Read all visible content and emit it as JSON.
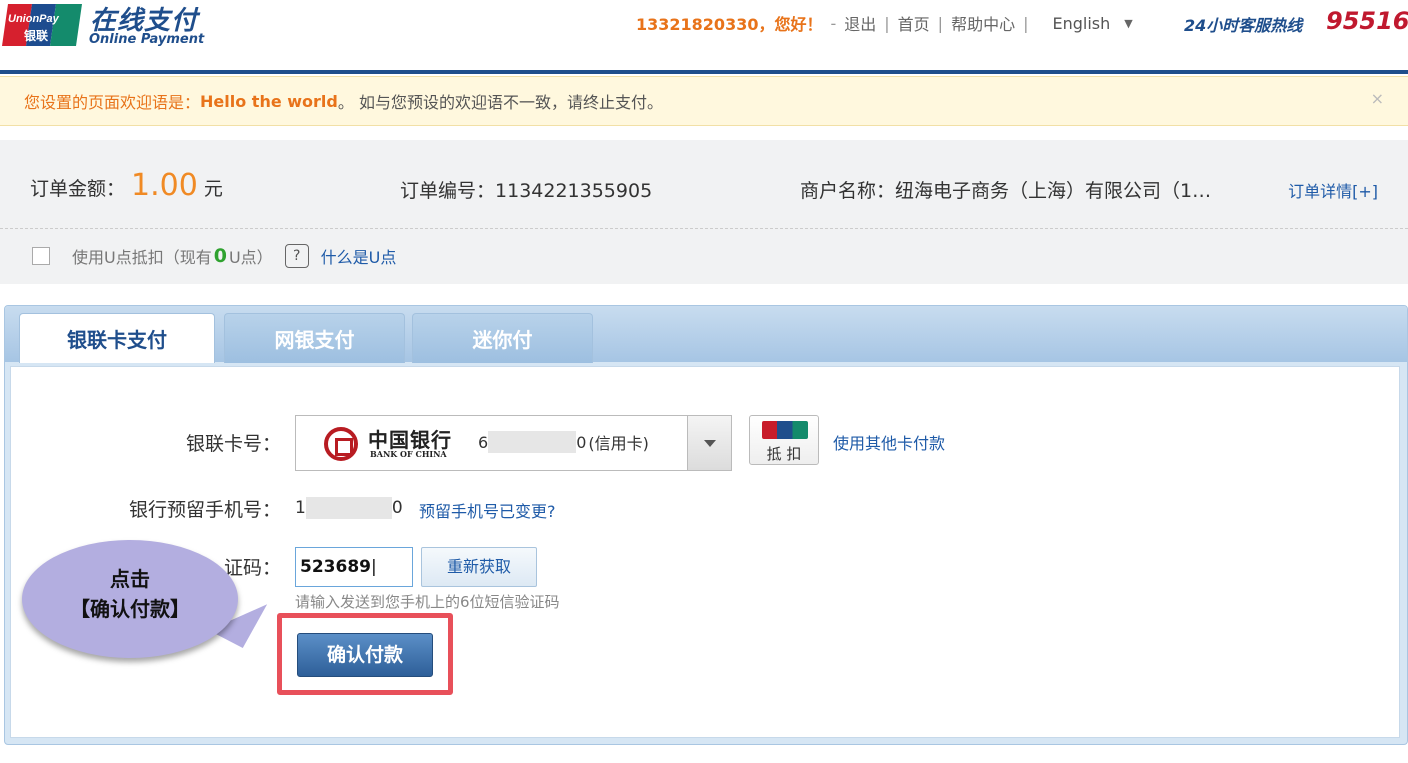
{
  "header": {
    "logo_brand": "UnionPay",
    "logo_sub": "银联",
    "title_cn": "在线支付",
    "title_en": "Online Payment",
    "user": "13321820330，您好！",
    "logout": "退出",
    "home": "首页",
    "help": "帮助中心",
    "language": "English",
    "hotline_label": "24小时客服热线",
    "hotline_number": "95516"
  },
  "notice": {
    "prefix": "您设置的页面欢迎语是：",
    "greeting": "Hello the world",
    "suffix": "。 如与您预设的欢迎语不一致，请终止支付。",
    "close": "×"
  },
  "order": {
    "amount_label": "订单金额：",
    "amount": "1.00",
    "currency": "元",
    "order_no_label": "订单编号：",
    "order_no": "1134221355905",
    "merchant_label": "商户名称：",
    "merchant": "纽海电子商务（上海）有限公司（1…",
    "detail_link": "订单详情[+]",
    "upoint_text_1": "使用U点抵扣（现有",
    "upoint_count": "0",
    "upoint_text_2": "U点）",
    "upoint_help": "?",
    "upoint_link": "什么是U点"
  },
  "tabs": [
    {
      "label": "银联卡支付",
      "active": true
    },
    {
      "label": "网银支付",
      "active": false
    },
    {
      "label": "迷你付",
      "active": false
    }
  ],
  "form": {
    "card_label": "银联卡号：",
    "bank_name_cn": "中国银行",
    "bank_name_en": "BANK OF CHINA",
    "card_first": "6",
    "card_last": "0",
    "card_type": "(信用卡)",
    "discount_label": "抵 扣",
    "other_card": "使用其他卡付款",
    "phone_label": "银行预留手机号：",
    "phone_first": "1",
    "phone_last": "0",
    "phone_change": "预留手机号已变更?",
    "code_label": "证码：",
    "code_value": "523689",
    "resend": "重新获取",
    "hint": "请输入发送到您手机上的6位短信验证码",
    "confirm": "确认付款"
  },
  "callout": {
    "line1": "点击",
    "line2": "【确认付款】"
  },
  "colors": {
    "brand_blue": "#1f4e8c",
    "accent_orange": "#e8731a",
    "highlight_red": "#e8505a",
    "callout_purple": "#b3aee0"
  }
}
